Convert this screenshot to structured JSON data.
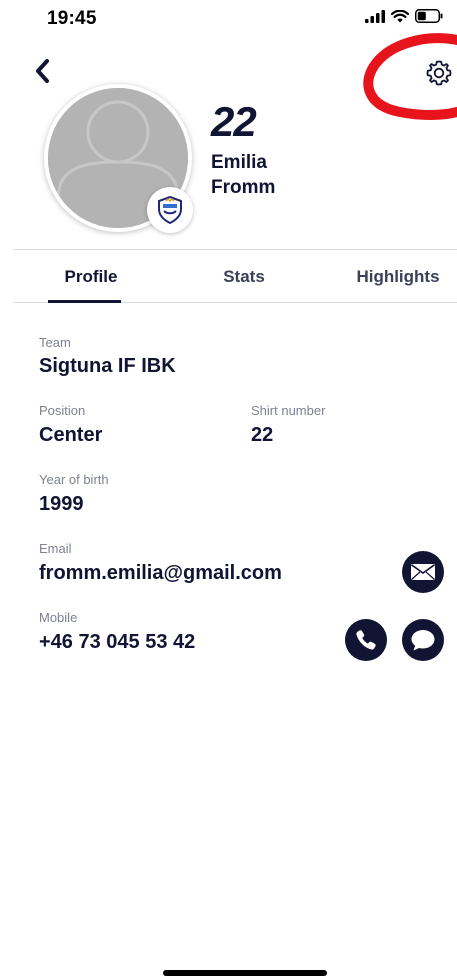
{
  "status_bar": {
    "time": "19:45"
  },
  "player": {
    "number": "22",
    "first_name": "Emilia",
    "last_name": "Fromm"
  },
  "tabs": [
    {
      "label": "Profile",
      "active": true
    },
    {
      "label": "Stats",
      "active": false
    },
    {
      "label": "Highlights",
      "active": false
    }
  ],
  "fields": {
    "team": {
      "label": "Team",
      "value": "Sigtuna IF IBK"
    },
    "position": {
      "label": "Position",
      "value": "Center"
    },
    "shirt_number": {
      "label": "Shirt number",
      "value": "22"
    },
    "year_of_birth": {
      "label": "Year of birth",
      "value": "1999"
    },
    "email": {
      "label": "Email",
      "value": "fromm.emilia@gmail.com"
    },
    "mobile": {
      "label": "Mobile",
      "value": "+46 73 045 53 42"
    }
  },
  "icons": {
    "back": "chevron-left-icon",
    "settings": "gear-icon",
    "email": "envelope-icon",
    "call": "phone-icon",
    "message": "chat-bubble-icon"
  },
  "colors": {
    "primary": "#111533",
    "annotation": "#e8141c",
    "label": "#7d8192",
    "avatar_placeholder": "#b3b3b3"
  }
}
